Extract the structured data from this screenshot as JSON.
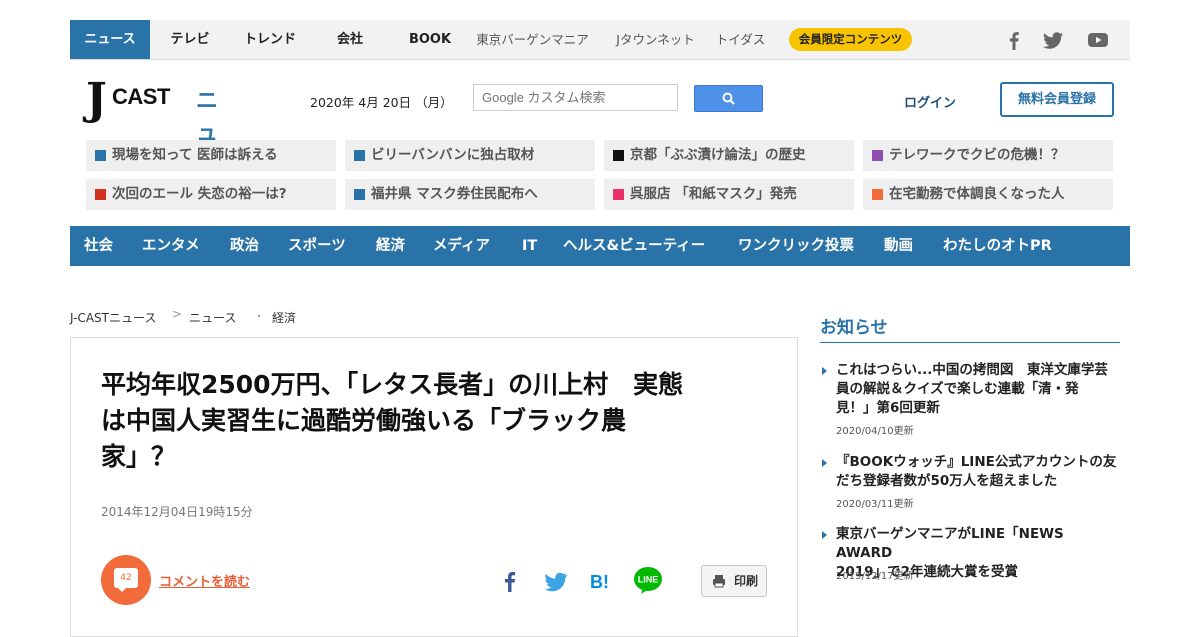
{
  "top_nav": {
    "items": [
      {
        "label": "ニュース",
        "active": true
      },
      {
        "label": "テレビ"
      },
      {
        "label": "トレンド"
      },
      {
        "label": "会社"
      },
      {
        "label": "BOOK"
      },
      {
        "label": "東京バーゲンマニア"
      },
      {
        "label": "Jタウンネット"
      },
      {
        "label": "トイダス"
      }
    ],
    "members_badge": "会員限定コンテンツ",
    "social": [
      "facebook-icon",
      "twitter-icon",
      "youtube-icon"
    ]
  },
  "header": {
    "logo": {
      "j": "J",
      "cast": "CAST",
      "news": "ニュース"
    },
    "date": "2020年 4月 20日 （月）",
    "search_placeholder": "Google カスタム検索",
    "login": "ログイン",
    "signup": "無料会員登録"
  },
  "topics": [
    {
      "label": "現場を知って 医師は訴える",
      "color": "#2a73a8"
    },
    {
      "label": "ビリーバンバンに独占取材",
      "color": "#2a73a8"
    },
    {
      "label": "京都「ぶぶ漬け論法」の歴史",
      "color": "#111111"
    },
    {
      "label": "テレワークでクビの危機！？",
      "color": "#8e4fb0"
    },
    {
      "label": "次回のエール 失恋の裕一は?",
      "color": "#d0311f"
    },
    {
      "label": "福井県 マスク券住民配布へ",
      "color": "#2a73a8"
    },
    {
      "label": "呉服店 「和紙マスク」発売",
      "color": "#e8306b"
    },
    {
      "label": "在宅勤務で体調良くなった人",
      "color": "#f26b3a"
    }
  ],
  "categories": [
    "社会",
    "エンタメ",
    "政治",
    "スポーツ",
    "経済",
    "メディア",
    "IT",
    "ヘルス&ビューティー",
    "ワンクリック投票",
    "動画",
    "わたしのオトPR"
  ],
  "breadcrumb": {
    "home": "J-CASTニュース",
    "sep1": ">",
    "section": "ニュース",
    "sep2": "・",
    "sub": "経済"
  },
  "article": {
    "headline_line1": "平均年収2500万円、「レタス長者」の川上村　実態",
    "headline_line2": "は中国人実習生に過酷労働強いる「ブラック農",
    "headline_line3": "家」？",
    "timestamp": "2014年12月04日19時15分",
    "comment_count": "42",
    "comment_link": "コメントを読む",
    "print": "印刷"
  },
  "sidebar": {
    "title": "お知らせ",
    "notices": [
      {
        "title_line1": "これはつらい...中国の拷問図　東洋文庫学芸",
        "title_line2": "員の解説＆クイズで楽しむ連載「清・発",
        "title_line3": "見！」第6回更新",
        "date": "2020/04/10更新"
      },
      {
        "title_line1": "『BOOKウォッチ』LINE公式アカウントの友",
        "title_line2": "だち登録者数が50万人を超えました",
        "date": "2020/03/11更新"
      },
      {
        "title_line1": "東京バーゲンマニアがLINE「NEWS AWARD",
        "title_line2": "2019」で2年連続大賞を受賞",
        "date": "2019/12/17更新"
      }
    ]
  }
}
